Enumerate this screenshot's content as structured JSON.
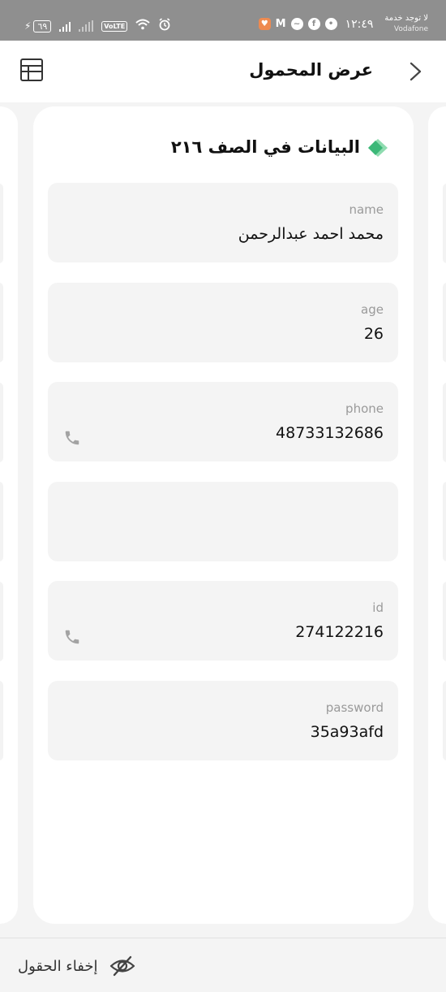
{
  "status_bar": {
    "battery": "٦٩",
    "volte": "VoLTE",
    "time": "١٢:٤٩",
    "service": "لا توجد خدمة",
    "carrier": "Vodafone"
  },
  "header": {
    "title": "عرض المحمول",
    "back_icon": "chevron-right-icon",
    "table_icon": "table-icon"
  },
  "card": {
    "title": "البيانات في الصف ٢١٦",
    "fields": [
      {
        "label": "name",
        "value": "محمد احمد عبدالرحمن",
        "has_phone": false
      },
      {
        "label": "age",
        "value": "26",
        "has_phone": false
      },
      {
        "label": "phone",
        "value": "48733132686",
        "has_phone": true
      },
      {
        "label": "",
        "value": "",
        "has_phone": false
      },
      {
        "label": "id",
        "value": "274122216",
        "has_phone": true
      },
      {
        "label": "password",
        "value": "35a93afd",
        "has_phone": false
      }
    ]
  },
  "bottom": {
    "hide_fields_label": "إخفاء الحقول"
  },
  "colors": {
    "accent_green": "#3cb878",
    "accent_light_green": "#8fdcb0",
    "status_bar": "#8f8f8f",
    "field_bg": "#f4f4f4"
  }
}
